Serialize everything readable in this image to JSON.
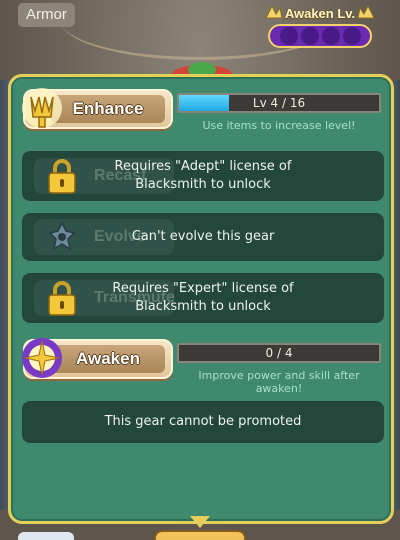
{
  "header": {
    "category_label": "Armor",
    "awaken_level_label": "Awaken Lv.",
    "awaken_level_filled": 0,
    "awaken_level_max": 4
  },
  "enhance": {
    "button_label": "Enhance",
    "icon": "crown-trident-icon",
    "progress_text": "Lv 4 / 16",
    "progress_fraction": 0.25,
    "hint": "Use items to increase level!"
  },
  "recast": {
    "ghost_label": "Recast",
    "icon": "padlock-icon",
    "message_line1": "Requires \"Adept\" license of",
    "message_line2": "Blacksmith to unlock"
  },
  "evolve": {
    "ghost_label": "Evolve",
    "icon": "evolve-gear-icon",
    "message": "Can't evolve this gear"
  },
  "transmute": {
    "ghost_label": "Transmute",
    "icon": "padlock-icon",
    "message_line1": "Requires \"Expert\" license of",
    "message_line2": "Blacksmith to unlock"
  },
  "awaken": {
    "button_label": "Awaken",
    "icon": "awaken-sparkle-icon",
    "progress_text": "0 / 4",
    "progress_fraction": 0,
    "hint": "Improve power and skill after awaken!"
  },
  "promote": {
    "message": "This gear cannot be promoted"
  },
  "colors": {
    "panel_green": "#3f8a6f",
    "row_dark": "#24473c",
    "panel_border_gold": "#e4cf5b",
    "progress_blue": "#20a8e0",
    "awaken_purple": "#6a2bb0"
  }
}
